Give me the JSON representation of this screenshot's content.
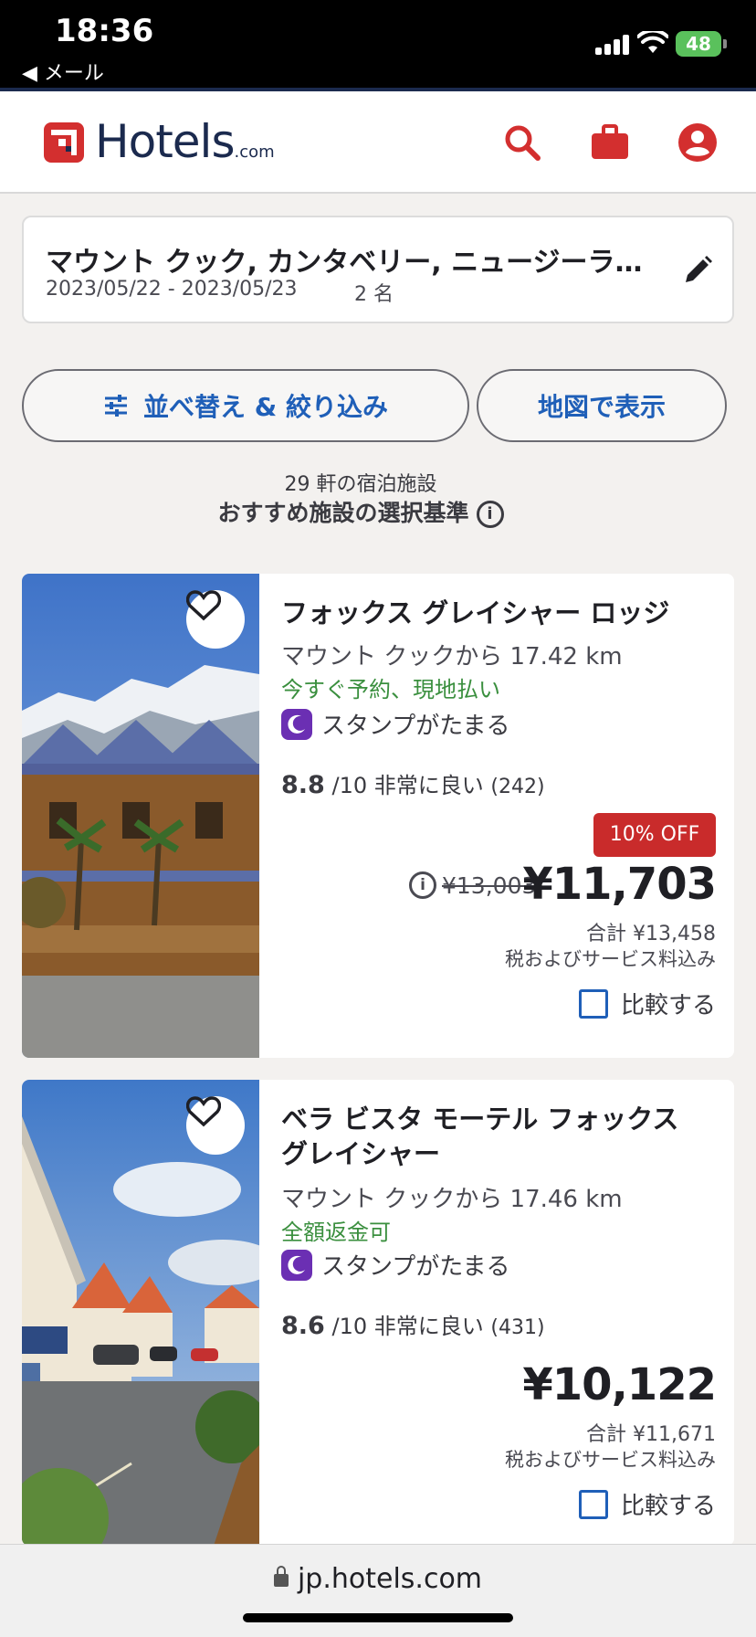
{
  "status_bar": {
    "time": "18:36",
    "back_label": "◀ メール",
    "battery": "48"
  },
  "header": {
    "logo_text": "Hotels",
    "logo_suffix": ".com",
    "icons": [
      "search-icon",
      "briefcase-icon",
      "account-icon"
    ],
    "brand_color": "#d32f2f"
  },
  "search": {
    "destination": "マウント クック, カンタベリー, ニュージーランド",
    "dates": "2023/05/22 - 2023/05/23",
    "guests": "2 名"
  },
  "actions": {
    "sort_filter": "並べ替え & 絞り込み",
    "map": "地図で表示"
  },
  "results": {
    "count": "29 軒の宿泊施設",
    "criteria": "おすすめ施設の選択基準",
    "info_icon": "i"
  },
  "hotels": [
    {
      "name": "フォックス グレイシャー ロッジ",
      "distance": "マウント クックから 17.42 km",
      "policy": "今すぐ予約、現地払い",
      "stamp": "スタンプがたまる",
      "score": "8.8",
      "score_suffix": "/10 非常に良い",
      "reviews": "(242)",
      "discount": "10% OFF",
      "info_icon": "i",
      "old_price": "¥13,003",
      "price": "¥11,703",
      "total": "合計 ¥13,458",
      "tax_note": "税およびサービス料込み",
      "compare": "比較する"
    },
    {
      "name": "ベラ ビスタ モーテル フォックス グレイシャー",
      "distance": "マウント クックから 17.46 km",
      "policy": "全額返金可",
      "stamp": "スタンプがたまる",
      "score": "8.6",
      "score_suffix": "/10 非常に良い",
      "reviews": "(431)",
      "price": "¥10,122",
      "total": "合計 ¥11,671",
      "tax_note": "税およびサービス料込み",
      "compare": "比較する"
    }
  ],
  "browser": {
    "url": "jp.hotels.com"
  },
  "colors": {
    "accent_blue": "#1f5fb8",
    "policy_green": "#3a8f3e",
    "discount_red": "#c92b2b",
    "stamp_purple": "#6b2fb3"
  }
}
